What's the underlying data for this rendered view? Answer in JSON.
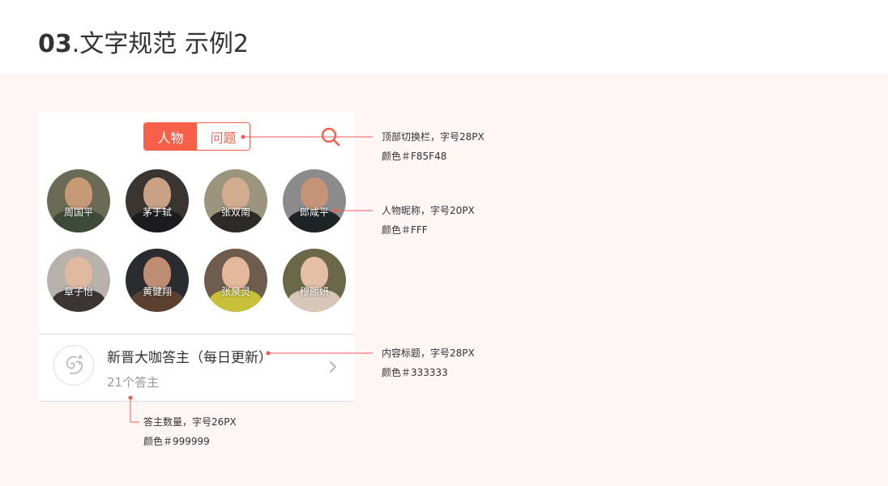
{
  "page": {
    "title_num": "03",
    "title_text": ".文字规范 示例2"
  },
  "colors": {
    "accent": "#F85F48",
    "title": "#333333",
    "subtitle": "#999999",
    "canvas": "#FDF6F5"
  },
  "tabs": {
    "people": "人物",
    "questions": "问题",
    "active": "people"
  },
  "search": {
    "icon": "search-icon"
  },
  "people": [
    {
      "name": "周国平"
    },
    {
      "name": "茅于轼"
    },
    {
      "name": "张双南"
    },
    {
      "name": "郎咸平"
    },
    {
      "name": "章子怡"
    },
    {
      "name": "黄健翔"
    },
    {
      "name": "张泉灵"
    },
    {
      "name": "穆熙妍"
    }
  ],
  "list": {
    "title": "新晋大咖答主（每日更新）",
    "subtitle": "21个答主",
    "icon": "squirrel-icon",
    "chevron": "chevron-right-icon"
  },
  "annotations": {
    "tabs": {
      "line1": "顶部切换栏，字号28PX",
      "line2": "颜色＃F85F48"
    },
    "nickname": {
      "line1": "人物昵称，字号20PX",
      "line2": "颜色＃FFF"
    },
    "title": {
      "line1": "内容标题，字号28PX",
      "line2": "颜色＃333333"
    },
    "count": {
      "line1": "答主数量，字号26PX",
      "line2": "颜色＃999999"
    }
  }
}
